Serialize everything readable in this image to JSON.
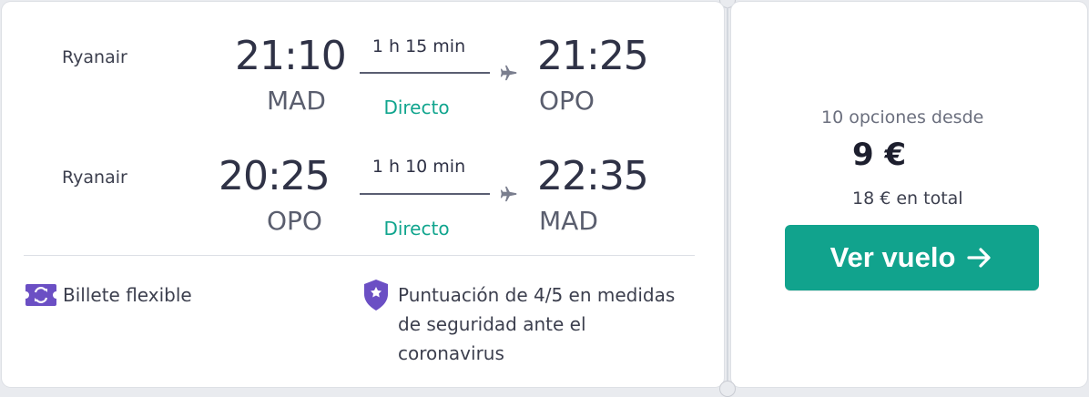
{
  "colors": {
    "accent_teal": "#11a38d",
    "direct_green": "#11a58e",
    "feature_purple": "#6b4fc4",
    "text_dark": "#2f3246"
  },
  "legs": [
    {
      "airline": "Ryanair",
      "depart_time": "21:10",
      "depart_code": "MAD",
      "duration": "1 h 15 min",
      "stops": "Directo",
      "arrive_time": "21:25",
      "arrive_code": "OPO",
      "icon": "plane-icon"
    },
    {
      "airline": "Ryanair",
      "depart_time": "20:25",
      "depart_code": "OPO",
      "duration": "1 h 10 min",
      "stops": "Directo",
      "arrive_time": "22:35",
      "arrive_code": "MAD",
      "icon": "plane-icon"
    }
  ],
  "features": {
    "flexible": {
      "icon": "flexible-ticket-icon",
      "text": "Billete flexible"
    },
    "safety": {
      "icon": "shield-icon",
      "line1": "Puntuación de 4/5 en medidas",
      "line2": "de seguridad ante el",
      "line3": "coronavirus"
    }
  },
  "price_panel": {
    "options": "10 opciones desde",
    "price": "9 €",
    "total": "18 € en total",
    "button_label": "Ver vuelo",
    "button_icon": "arrow-right-icon"
  }
}
